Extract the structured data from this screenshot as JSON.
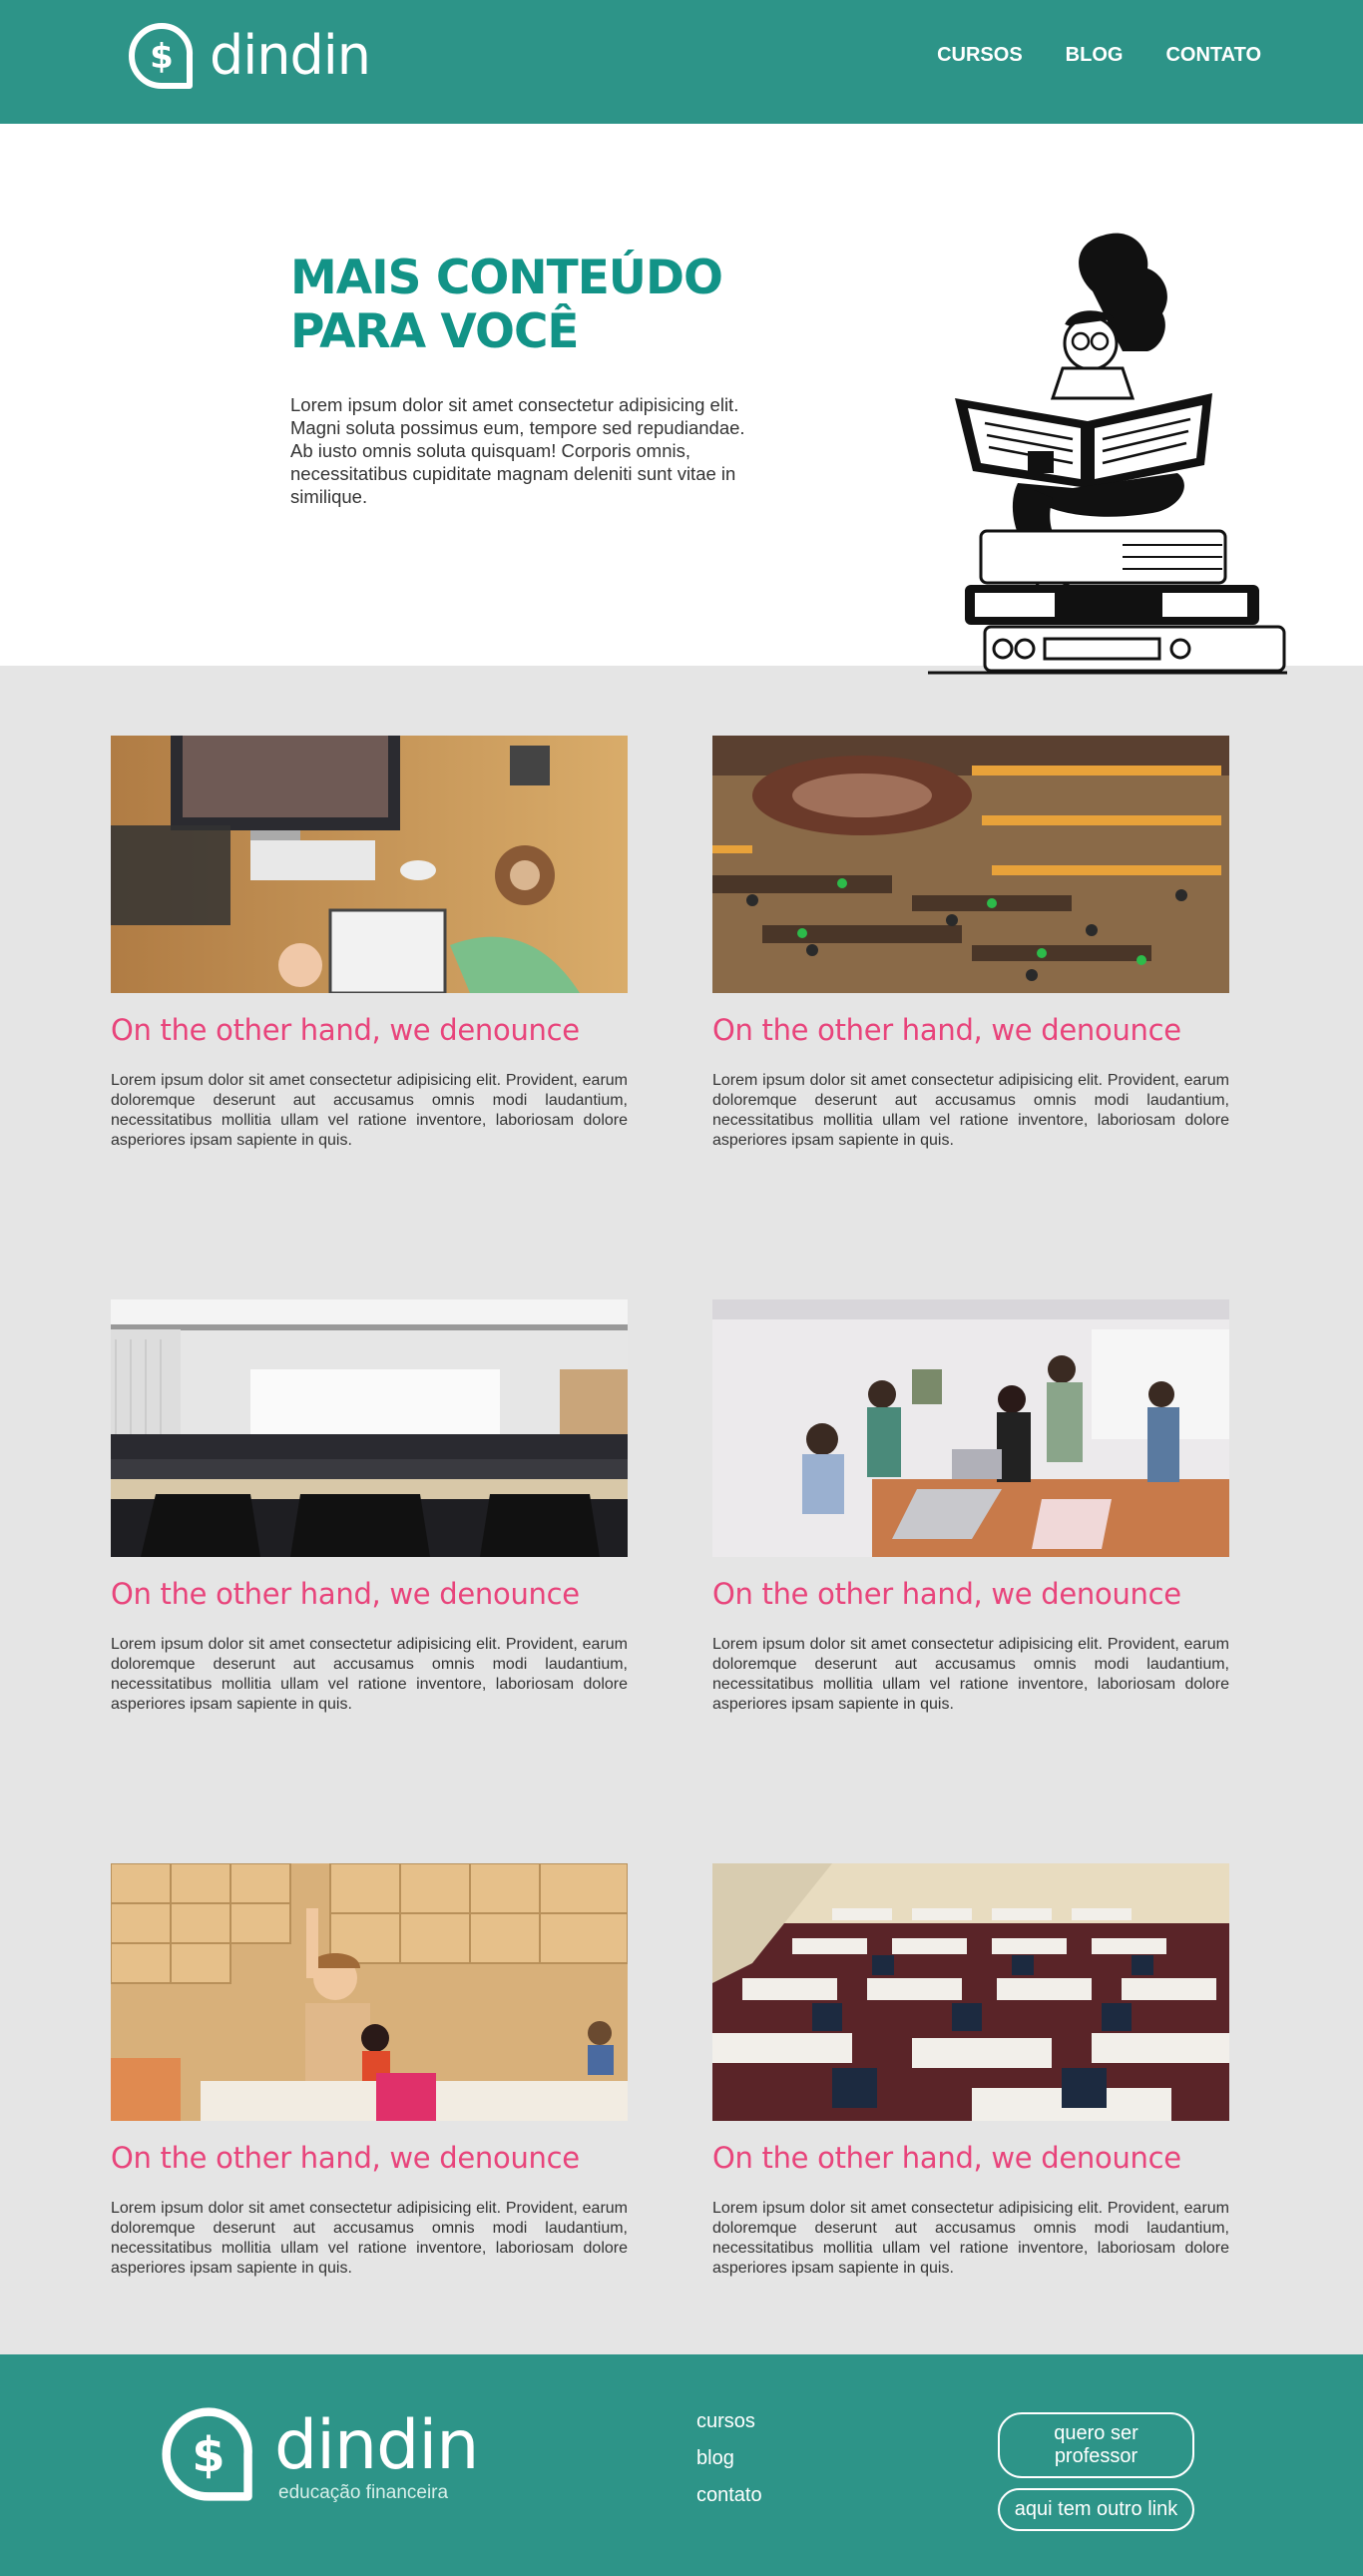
{
  "header": {
    "logo_text": "dindin",
    "nav": [
      "CURSOS",
      "BLOG",
      "CONTATO"
    ]
  },
  "hero": {
    "title_line1": "MAIS CONTEÚDO",
    "title_line2": "PARA VOCÊ",
    "text": "Lorem ipsum dolor sit amet consectetur adipisicing elit. Magni soluta possimus eum, tempore sed repudiandae. Ab iusto omnis soluta quisquam! Corporis omnis, necessitatibus cupiditate magnam deleniti sunt vitae in similique."
  },
  "cards": [
    {
      "image": "desk-video-call-photo",
      "title": "On the other hand, we denounce",
      "text": "Lorem ipsum dolor sit amet consectetur adipisicing elit. Provident, earum doloremque deserunt aut accusamus omnis modi laudantium, necessitatibus mollitia ullam vel ratione inventore, laboriosam dolore asperiores ipsam sapiente in quis."
    },
    {
      "image": "library-aerial-photo",
      "title": "On the other hand, we denounce",
      "text": "Lorem ipsum dolor sit amet consectetur adipisicing elit. Provident, earum doloremque deserunt aut accusamus omnis modi laudantium, necessitatibus mollitia ullam vel ratione inventore, laboriosam dolore asperiores ipsam sapiente in quis."
    },
    {
      "image": "lecture-hall-photo",
      "title": "On the other hand, we denounce",
      "text": "Lorem ipsum dolor sit amet consectetur adipisicing elit. Provident, earum doloremque deserunt aut accusamus omnis modi laudantium, necessitatibus mollitia ullam vel ratione inventore, laboriosam dolore asperiores ipsam sapiente in quis."
    },
    {
      "image": "students-laptops-photo",
      "title": "On the other hand, we denounce",
      "text": "Lorem ipsum dolor sit amet consectetur adipisicing elit. Provident, earum doloremque deserunt aut accusamus omnis modi laudantium, necessitatibus mollitia ullam vel ratione inventore, laboriosam dolore asperiores ipsam sapiente in quis."
    },
    {
      "image": "classroom-kids-photo",
      "title": "On the other hand, we denounce",
      "text": "Lorem ipsum dolor sit amet consectetur adipisicing elit. Provident, earum doloremque deserunt aut accusamus omnis modi laudantium, necessitatibus mollitia ullam vel ratione inventore, laboriosam dolore asperiores ipsam sapiente in quis."
    },
    {
      "image": "empty-classroom-desks-photo",
      "title": "On the other hand, we denounce",
      "text": "Lorem ipsum dolor sit amet consectetur adipisicing elit. Provident, earum doloremque deserunt aut accusamus omnis modi laudantium, necessitatibus mollitia ullam vel ratione inventore, laboriosam dolore asperiores ipsam sapiente in quis."
    }
  ],
  "footer": {
    "logo_text": "dindin",
    "tagline": "educação financeira",
    "links": [
      "cursos",
      "blog",
      "contato"
    ],
    "buttons": [
      "quero ser professor",
      "aqui tem outro link"
    ]
  },
  "colors": {
    "brand_teal": "#2d9488",
    "title_teal": "#129387",
    "card_title_pink": "#e8447b",
    "cards_background": "#e5e5e5"
  }
}
